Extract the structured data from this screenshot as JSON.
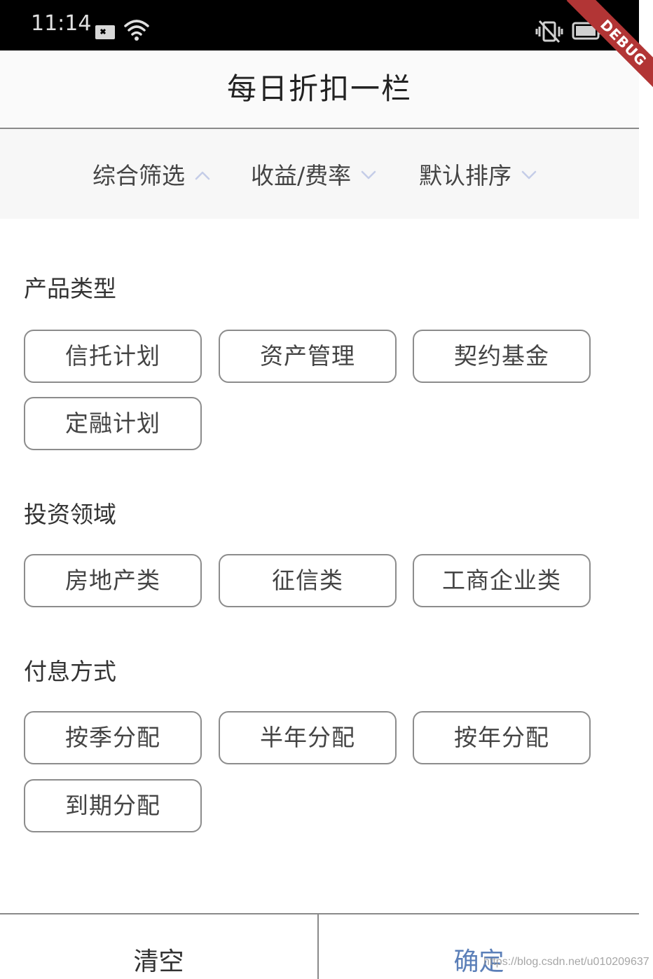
{
  "status_bar": {
    "time": "11:14",
    "icons": [
      "sim-card-icon",
      "wifi-icon",
      "vibrate-icon",
      "battery-icon"
    ]
  },
  "debug_banner": "DEBUG",
  "header": {
    "title": "每日折扣一栏"
  },
  "filter_tabs": [
    {
      "label": "综合筛选",
      "chevron": "chevron-up-icon"
    },
    {
      "label": "收益/费率",
      "chevron": "chevron-down-icon"
    },
    {
      "label": "默认排序",
      "chevron": "chevron-down-icon"
    }
  ],
  "sections": [
    {
      "title": "产品类型",
      "options": [
        "信托计划",
        "资产管理",
        "契约基金",
        "定融计划"
      ]
    },
    {
      "title": "投资领域",
      "options": [
        "房地产类",
        "征信类",
        "工商企业类"
      ]
    },
    {
      "title": "付息方式",
      "options": [
        "按季分配",
        "半年分配",
        "按年分配",
        "到期分配"
      ]
    }
  ],
  "bottom_bar": {
    "clear_label": "清空",
    "confirm_label": "确定"
  },
  "watermark": "https://blog.csdn.net/u010209637",
  "colors": {
    "debug_banner": "#b23535",
    "confirm_text": "#5b7fb8",
    "chip_border": "#8c8c8c",
    "chevron": "#c5cde8"
  }
}
